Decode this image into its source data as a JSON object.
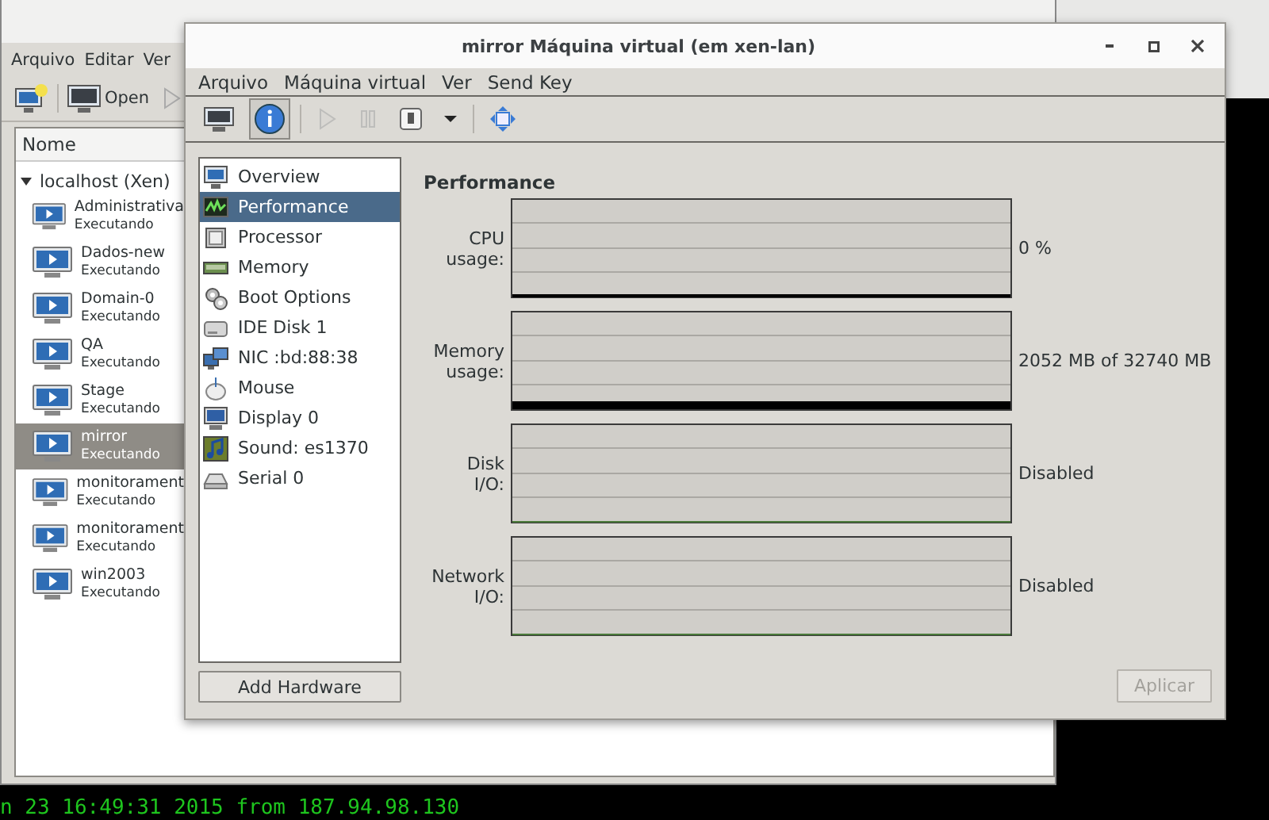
{
  "terminal": {
    "text": "n 23 16:49:31 2015 from 187.94.98.130"
  },
  "manager_window": {
    "menu": [
      "Arquivo",
      "Editar",
      "Ver"
    ],
    "toolbar": [
      {
        "kind": "new"
      },
      {
        "kind": "open",
        "label": "Open"
      },
      {
        "kind": "run"
      }
    ],
    "list": {
      "header": "Nome",
      "host": {
        "label": "localhost (Xen)",
        "expanded": true
      },
      "vms": [
        {
          "name": "Administrativa",
          "status": "Executando",
          "selected": false
        },
        {
          "name": "Dados-new",
          "status": "Executando",
          "selected": false
        },
        {
          "name": "Domain-0",
          "status": "Executando",
          "selected": false
        },
        {
          "name": "QA",
          "status": "Executando",
          "selected": false
        },
        {
          "name": "Stage",
          "status": "Executando",
          "selected": false
        },
        {
          "name": "mirror",
          "status": "Executando",
          "selected": true
        },
        {
          "name": "monitorament",
          "status": "Executando",
          "selected": false
        },
        {
          "name": "monitorament",
          "status": "Executando",
          "selected": false
        },
        {
          "name": "win2003",
          "status": "Executando",
          "selected": false
        }
      ]
    }
  },
  "vm_window": {
    "title": "mirror Máquina virtual (em xen-lan)",
    "menu": [
      "Arquivo",
      "Máquina virtual",
      "Ver",
      "Send Key"
    ],
    "toolbar": [
      {
        "kind": "console",
        "selected": false
      },
      {
        "kind": "details",
        "selected": true
      },
      {
        "kind": "run",
        "disabled": true
      },
      {
        "kind": "pause",
        "disabled": true
      },
      {
        "kind": "shutdown",
        "disabled": false
      },
      {
        "kind": "dropdown",
        "disabled": false
      },
      {
        "kind": "fullscreen",
        "disabled": false
      }
    ],
    "hardware": [
      {
        "label": "Overview",
        "kind": "monitor",
        "selected": false
      },
      {
        "label": "Performance",
        "kind": "graph",
        "selected": true
      },
      {
        "label": "Processor",
        "kind": "chip",
        "selected": false
      },
      {
        "label": "Memory",
        "kind": "ram",
        "selected": false
      },
      {
        "label": "Boot Options",
        "kind": "gears",
        "selected": false
      },
      {
        "label": "IDE Disk 1",
        "kind": "disk",
        "selected": false
      },
      {
        "label": "NIC :bd:88:38",
        "kind": "network",
        "selected": false
      },
      {
        "label": "Mouse",
        "kind": "mouse",
        "selected": false
      },
      {
        "label": "Display 0",
        "kind": "display",
        "selected": false
      },
      {
        "label": "Sound: es1370",
        "kind": "sound",
        "selected": false
      },
      {
        "label": "Serial 0",
        "kind": "serial",
        "selected": false
      }
    ],
    "add_button": "Add Hardware",
    "section_title": "Performance",
    "graphs": [
      {
        "label": "CPU\nusage:",
        "value": "0 %",
        "kind": "cpu"
      },
      {
        "label": "Memory\nusage:",
        "value": "2052 MB of 32740 MB",
        "kind": "memory"
      },
      {
        "label": "Disk\nI/O:",
        "value": "Disabled",
        "kind": "disabled"
      },
      {
        "label": "Network\nI/O:",
        "value": "Disabled",
        "kind": "disabled"
      }
    ],
    "apply_button": {
      "label": "Aplicar",
      "disabled": true
    }
  }
}
